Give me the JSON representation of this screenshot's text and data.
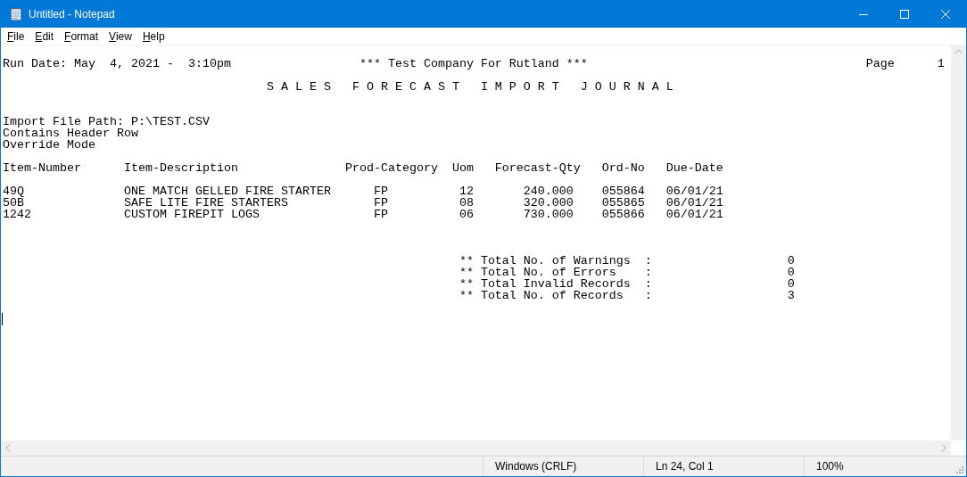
{
  "window": {
    "title": "Untitled - Notepad"
  },
  "menu": [
    "File",
    "Edit",
    "Format",
    "View",
    "Help"
  ],
  "report": {
    "header_line": "Run Date: May  4, 2021 -  3:10pm                  *** Test Company For Rutland ***                                       Page      1",
    "title_line": "                                     S A L E S   F O R E C A S T   I M P O R T   J O U R N A L",
    "import_info": [
      "Import File Path: P:\\TEST.CSV",
      "Contains Header Row",
      "Override Mode"
    ],
    "column_headers": "Item-Number      Item-Description               Prod-Category  Uom   Forecast-Qty   Ord-No   Due-Date",
    "rows": [
      "49Q              ONE MATCH GELLED FIRE STARTER      FP          12       240.000    055864   06/01/21",
      "50B              SAFE LITE FIRE STARTERS            FP          08       320.000    055865   06/01/21",
      "1242             CUSTOM FIREPIT LOGS                FP          06       730.000    055866   06/01/21"
    ],
    "totals": [
      "                                                                ** Total No. of Warnings  :                   0",
      "                                                                ** Total No. of Errors    :                   0",
      "                                                                ** Total Invalid Records  :                   0",
      "                                                                ** Total No. of Records   :                   3"
    ]
  },
  "status_bar": [
    "Windows (CRLF)",
    "Ln 24, Col 1",
    "100%"
  ]
}
